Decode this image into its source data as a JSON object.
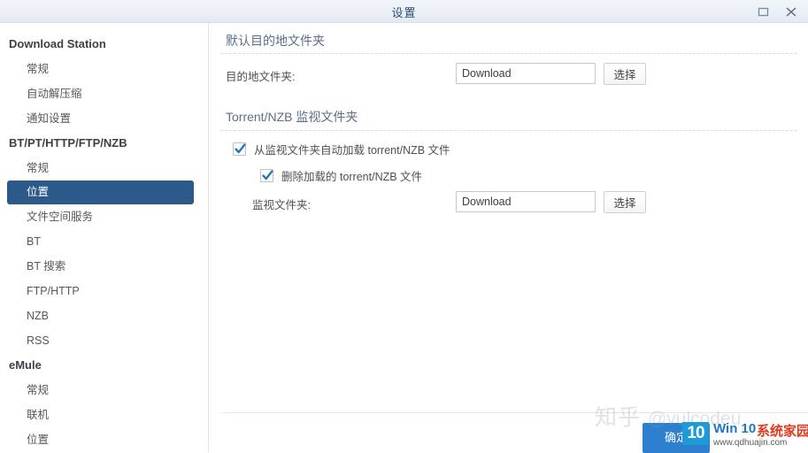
{
  "window": {
    "title": "设置",
    "maximize_icon": "maximize-icon",
    "close_icon": "close-icon"
  },
  "sidebar": {
    "groups": [
      {
        "title": "Download Station",
        "items": [
          {
            "label": "常规",
            "selected": false
          },
          {
            "label": "自动解压缩",
            "selected": false
          },
          {
            "label": "通知设置",
            "selected": false
          }
        ]
      },
      {
        "title": "BT/PT/HTTP/FTP/NZB",
        "items": [
          {
            "label": "常规",
            "selected": false
          },
          {
            "label": "位置",
            "selected": true
          },
          {
            "label": "文件空间服务",
            "selected": false
          },
          {
            "label": "BT",
            "selected": false
          },
          {
            "label": "BT 搜索",
            "selected": false
          },
          {
            "label": "FTP/HTTP",
            "selected": false
          },
          {
            "label": "NZB",
            "selected": false
          },
          {
            "label": "RSS",
            "selected": false
          }
        ]
      },
      {
        "title": "eMule",
        "items": [
          {
            "label": "常规",
            "selected": false
          },
          {
            "label": "联机",
            "selected": false
          },
          {
            "label": "位置",
            "selected": false
          }
        ]
      }
    ]
  },
  "content": {
    "section1": {
      "heading": "默认目的地文件夹",
      "dest_label": "目的地文件夹:",
      "dest_value": "Download",
      "dest_placeholder": "",
      "choose_label": "选择"
    },
    "section2": {
      "heading": "Torrent/NZB 监视文件夹",
      "auto_load_label": "从监视文件夹自动加载 torrent/NZB 文件",
      "auto_load_checked": true,
      "delete_loaded_label": "删除加载的 torrent/NZB 文件",
      "delete_loaded_checked": true,
      "watch_label": "监视文件夹:",
      "watch_value": "Download",
      "watch_placeholder": "",
      "choose_label": "选择"
    }
  },
  "footer": {
    "ok_label": "确定"
  },
  "watermarks": {
    "zhihu_logo": "知乎",
    "zhihu_handle": "@vulcodeu",
    "win10_ten": "10",
    "win10_brand_win": "Win 10",
    "win10_brand_cn": "系统家园",
    "win10_url": "www.qdhuajin.com"
  },
  "colors": {
    "accent": "#2b5a8a",
    "button_primary": "#2f7fd0",
    "heading": "#5c6f87",
    "checkmark": "#2176bd"
  }
}
